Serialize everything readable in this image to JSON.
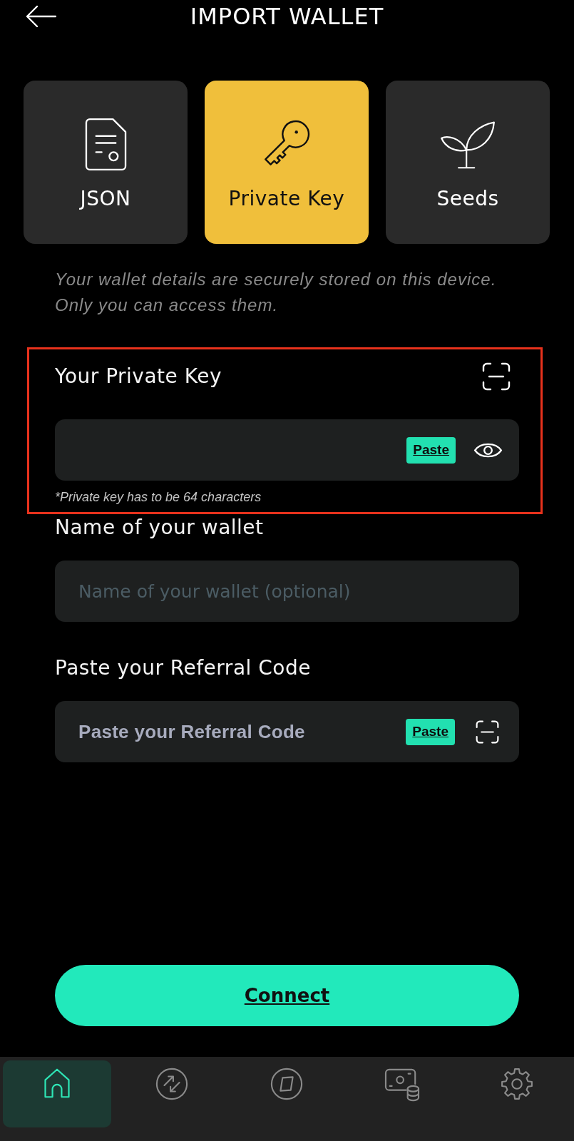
{
  "header": {
    "title": "IMPORT WALLET"
  },
  "tabs": [
    {
      "label": "JSON",
      "selected": false
    },
    {
      "label": "Private Key",
      "selected": true
    },
    {
      "label": "Seeds",
      "selected": false
    }
  ],
  "notice": "Your wallet details are securely stored on this device.\nOnly you can access them.",
  "fields": [
    {
      "kind": "secret",
      "label": "Your Private Key",
      "highlighted": true,
      "paste_label": "Paste",
      "hint": "*Private key has to be 64 characters"
    },
    {
      "kind": "text",
      "label": "Name of your wallet",
      "highlighted": false,
      "placeholder": "Name of your wallet (optional)"
    },
    {
      "kind": "referral",
      "label": "Paste your Referral Code",
      "highlighted": false,
      "placeholder": "Paste your Referral Code",
      "paste_label": "Paste"
    }
  ],
  "connect_button": "Connect",
  "nav": {
    "items": [
      {
        "selected": true
      },
      {
        "selected": false
      },
      {
        "selected": false
      },
      {
        "selected": false
      },
      {
        "selected": false
      }
    ]
  }
}
